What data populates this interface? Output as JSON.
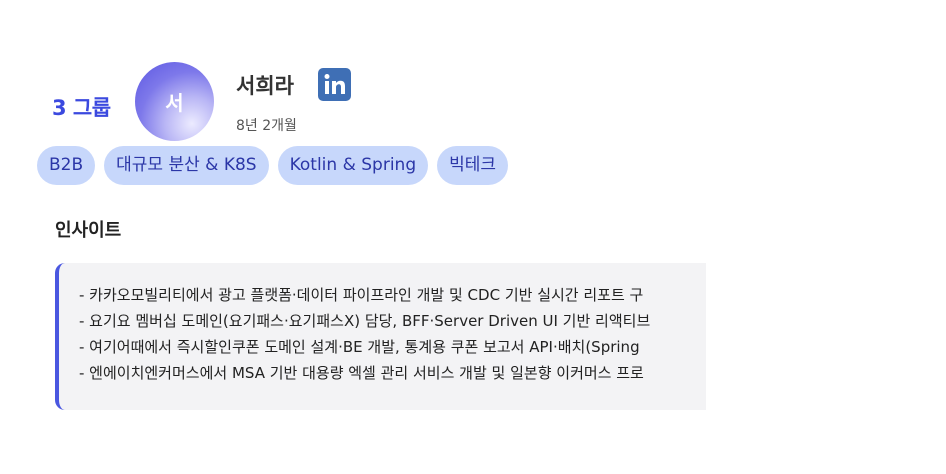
{
  "profile": {
    "group": "3 그룹",
    "avatar_initial": "서",
    "name": "서희라",
    "tenure": "8년 2개월",
    "linkedin_icon": "linkedin-icon",
    "linkedin_color": "#3f6fb5"
  },
  "tags": [
    {
      "label": "B2B"
    },
    {
      "label": "대규모 분산 & K8S"
    },
    {
      "label": "Kotlin & Spring"
    },
    {
      "label": "빅테크"
    }
  ],
  "insights": {
    "title": "인사이트",
    "items": [
      "- 카카오모빌리티에서 광고 플랫폼·데이터 파이프라인 개발 및 CDC 기반 실시간 리포트 구",
      "- 요기요 멤버십 도메인(요기패스·요기패스X) 담당, BFF·Server Driven UI 기반 리액티브",
      "- 여기어때에서 즉시할인쿠폰 도메인 설계·BE 개발, 통계용 쿠폰 보고서 API·배치(Spring",
      "- 엔에이치엔커머스에서 MSA 기반 대용량 엑셀 관리 서비스 개발 및 일본향 이커머스 프로"
    ]
  },
  "colors": {
    "accent": "#3b49df",
    "tag_bg": "#c7d7fb",
    "tag_text": "#2b36a7",
    "insight_border": "#4a57e0",
    "insight_bg": "#f3f3f5"
  }
}
